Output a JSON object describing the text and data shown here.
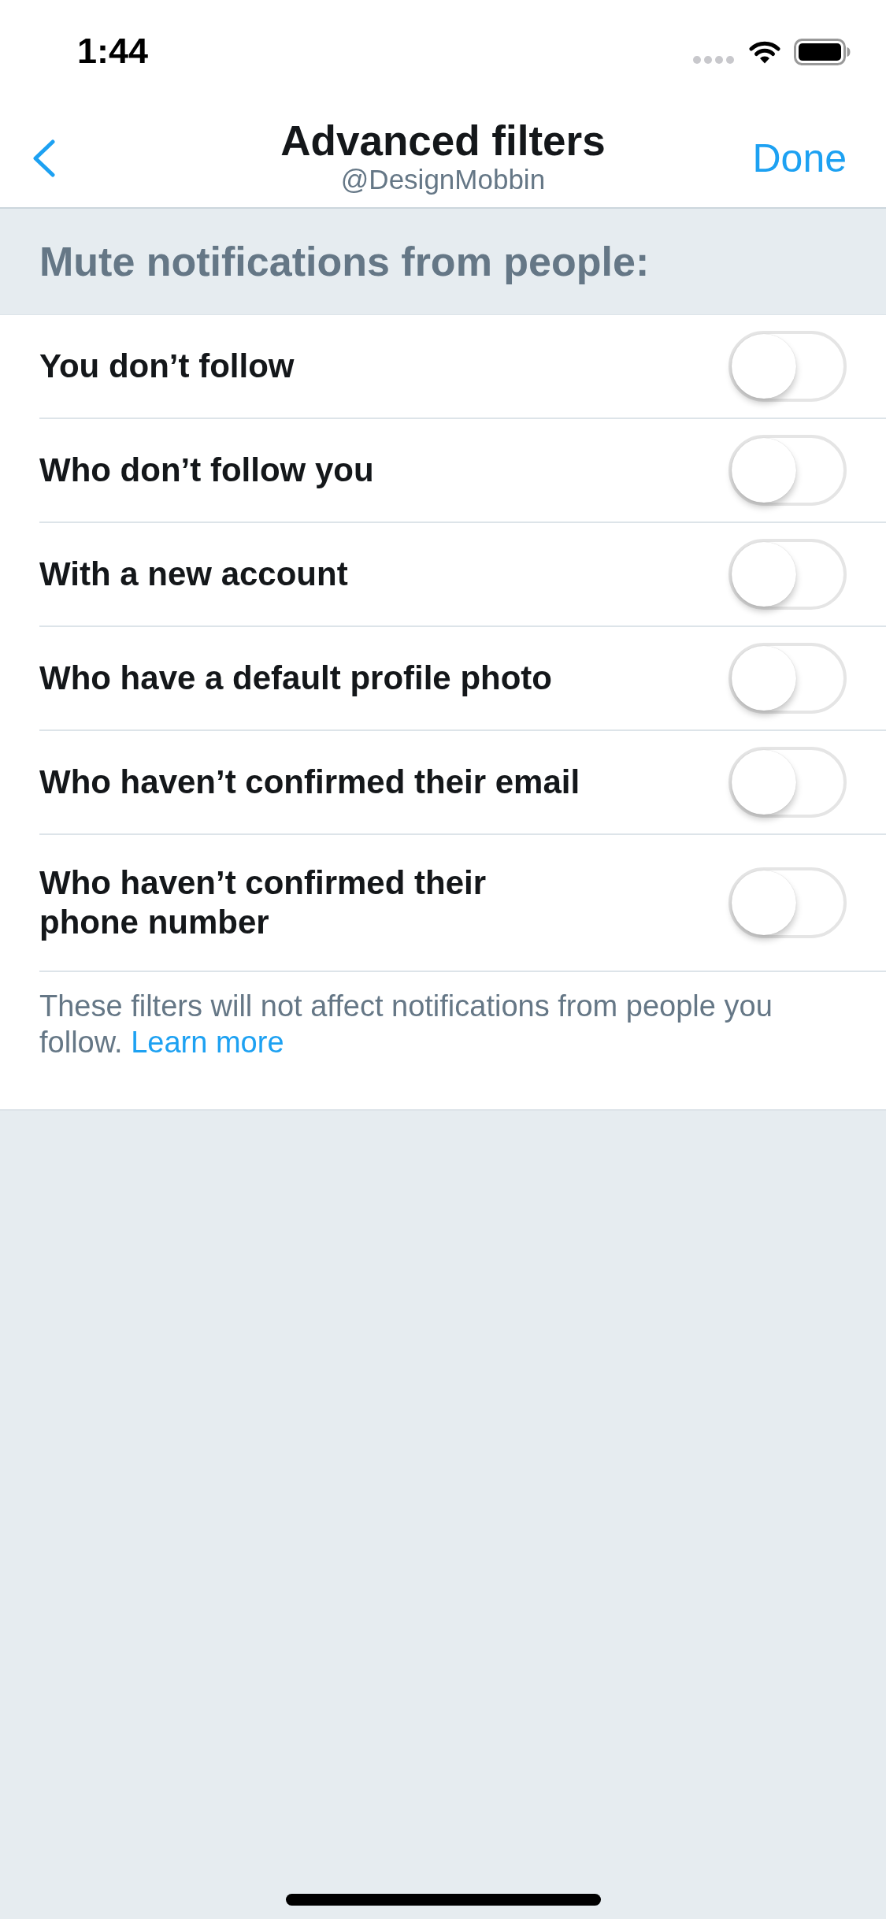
{
  "status_bar": {
    "time": "1:44"
  },
  "nav": {
    "title": "Advanced filters",
    "subtitle": "@DesignMobbin",
    "done": "Done"
  },
  "section": {
    "title": "Mute notifications from people:"
  },
  "filters": [
    {
      "label": "You don’t follow",
      "on": false
    },
    {
      "label": "Who don’t follow you",
      "on": false
    },
    {
      "label": "With a new account",
      "on": false
    },
    {
      "label": "Who have a default profile photo",
      "on": false
    },
    {
      "label": "Who haven’t confirmed their email",
      "on": false
    },
    {
      "label": "Who haven’t confirmed their\nphone number",
      "on": false
    }
  ],
  "footer": {
    "text": "These filters will not affect notifications from people you follow.",
    "link": "Learn more"
  }
}
